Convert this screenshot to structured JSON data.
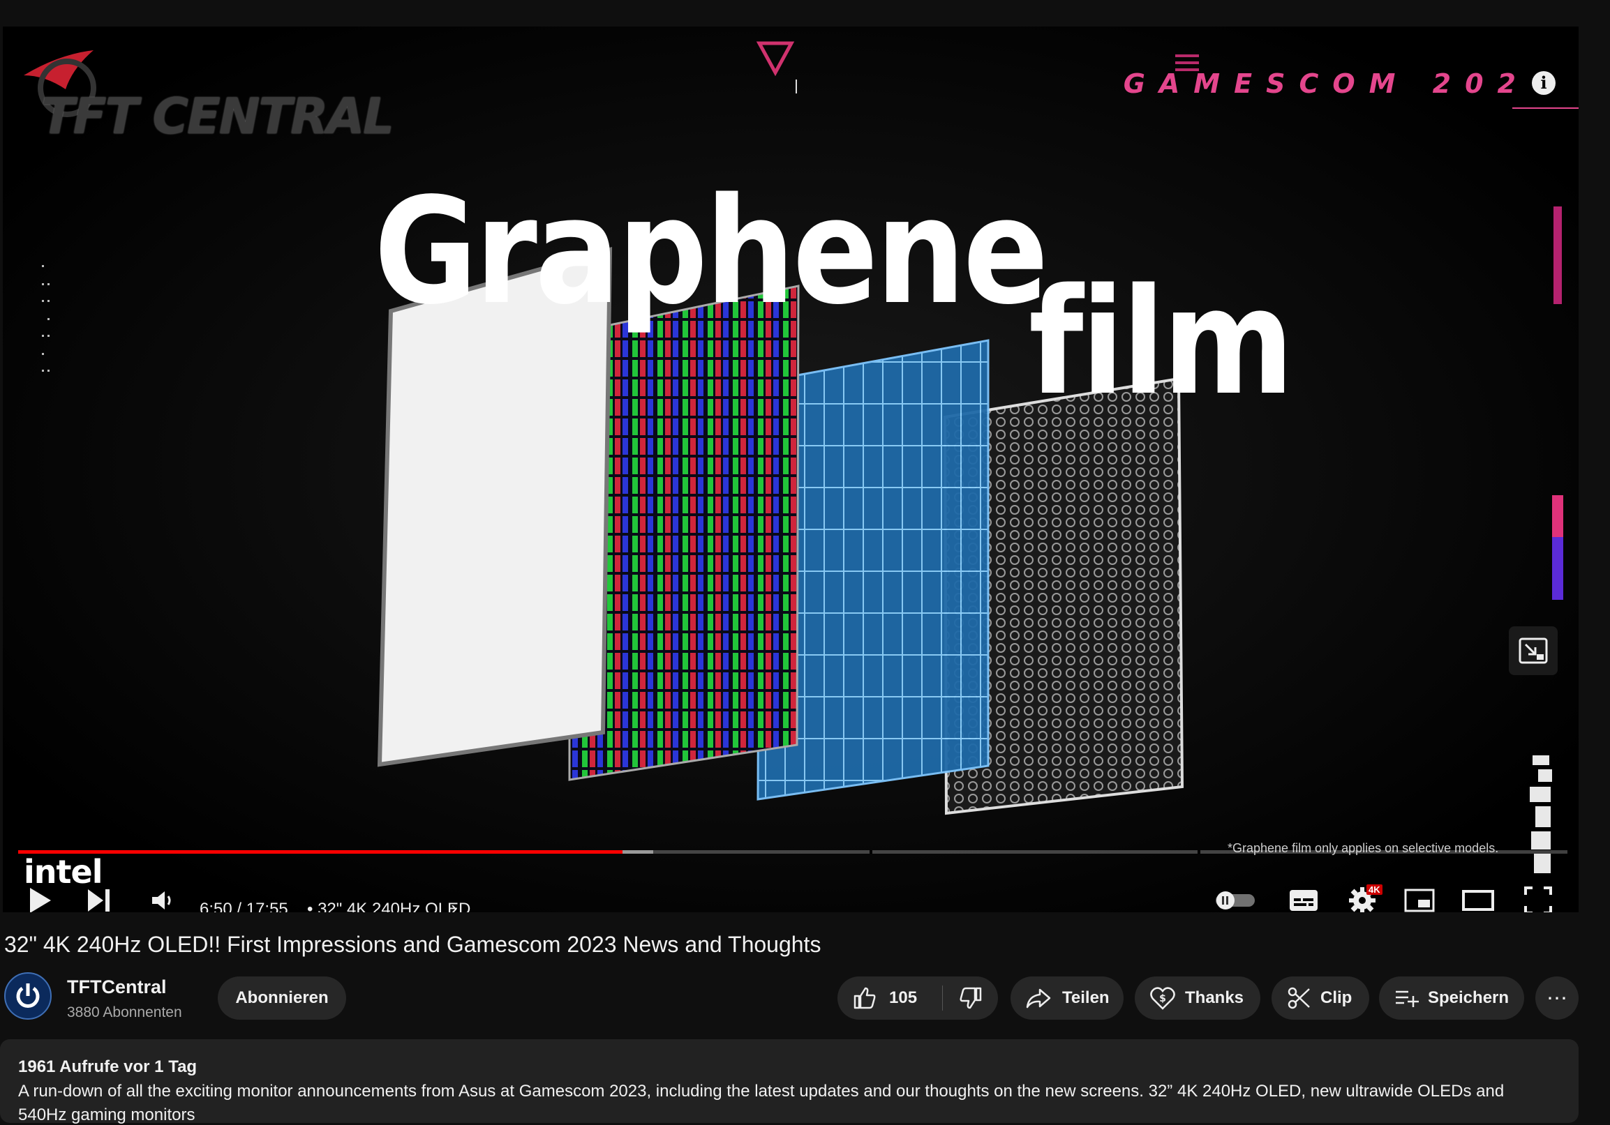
{
  "player": {
    "overlay": {
      "brand": "TFT CENTRAL",
      "event": "GAMESCOM 202",
      "headline_line1": "Graphene",
      "headline_line2": "film",
      "disclaimer": "*Graphene film only applies on selective models.",
      "sponsor": "intel"
    },
    "progress": {
      "played_fraction": 0.39,
      "buffered_fraction": 0.41
    },
    "time": "6:50 / 17:55",
    "chapter": "• 32\" 4K 240Hz OLED",
    "quality_badge": "4K",
    "icons": {
      "play": "play-icon",
      "next": "next-icon",
      "volume": "volume-icon",
      "autoplay": "autoplay-toggle",
      "subtitles": "subtitles-icon",
      "settings": "gear-icon",
      "miniplayer": "miniplayer-icon",
      "theater": "theater-icon",
      "fullscreen": "fullscreen-icon",
      "info": "info-icon"
    }
  },
  "video": {
    "title": "32\" 4K 240Hz OLED!! First Impressions and Gamescom 2023 News and Thoughts"
  },
  "channel": {
    "name": "TFTCentral",
    "subscribers": "3880 Abonnenten",
    "subscribe_label": "Abonnieren"
  },
  "actions": {
    "likes": "105",
    "share": "Teilen",
    "thanks": "Thanks",
    "clip": "Clip",
    "save": "Speichern",
    "more": "⋯"
  },
  "description": {
    "meta": "1961 Aufrufe  vor 1 Tag",
    "text": "A run-down of all the exciting monitor announcements from Asus at Gamescom 2023, including the latest updates and our thoughts on the new screens. 32” 4K 240Hz OLED, new ultrawide OLEDs and",
    "text_cont": "540Hz gaming monitors"
  },
  "colors": {
    "background": "#0f0f0f",
    "progress": "#ff0000",
    "pill": "#272727",
    "accent_event": "#e4468d"
  }
}
